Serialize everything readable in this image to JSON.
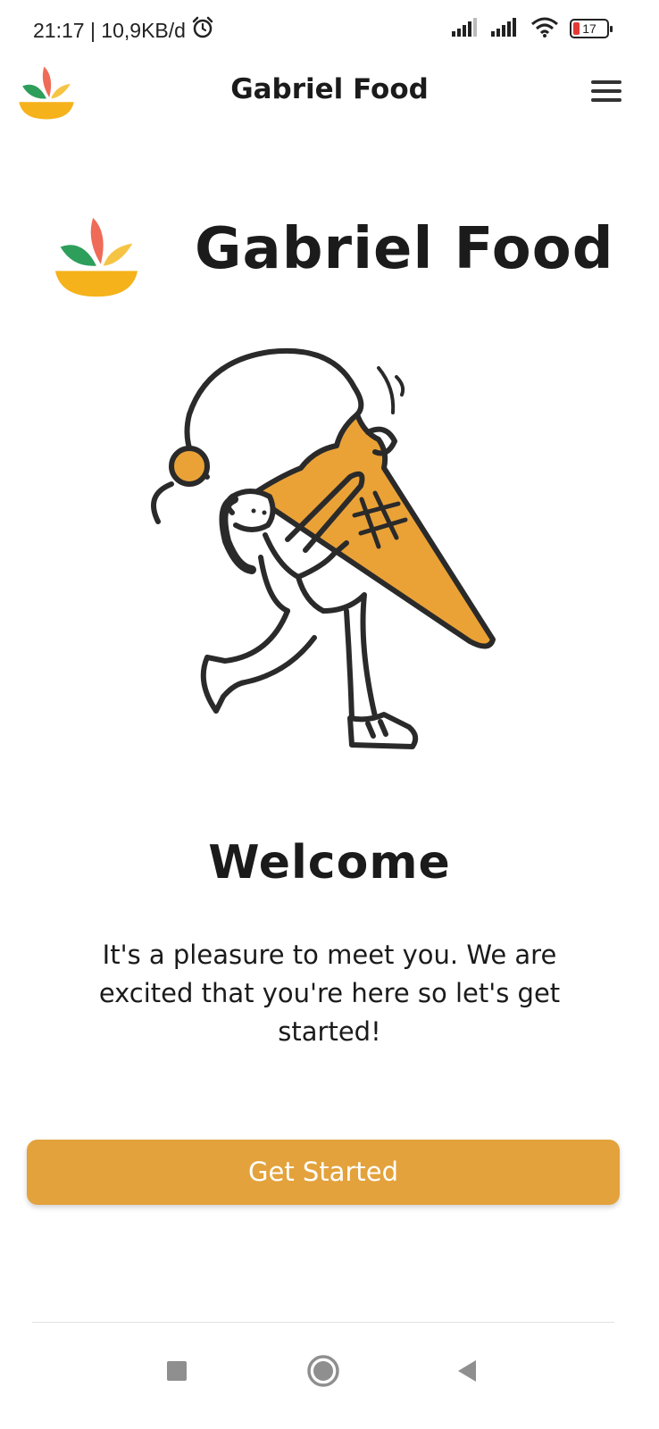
{
  "status_bar": {
    "time_and_speed": "21:17 | 10,9KB/d",
    "battery_level": "17",
    "icons": [
      "alarm-icon",
      "signal-icon",
      "signal-icon",
      "wifi-icon",
      "battery-icon"
    ]
  },
  "header": {
    "title": "Gabriel Food",
    "menu_icon": "hamburger-menu-icon"
  },
  "brand": {
    "title": "Gabriel Food"
  },
  "welcome": {
    "title": "Welcome",
    "message": "It's a pleasure to meet you. We are excited that you're here so let's get started!"
  },
  "cta": {
    "label": "Get Started"
  },
  "nav_bar": {
    "icons": [
      "recent-apps-icon",
      "home-icon",
      "back-icon"
    ]
  },
  "colors": {
    "accent": "#e3a23b",
    "logo_green": "#2e9e5b",
    "logo_red": "#ef6b57",
    "logo_yellow": "#f6c445",
    "logo_bowl": "#f5b21b",
    "text": "#1b1b1b"
  }
}
